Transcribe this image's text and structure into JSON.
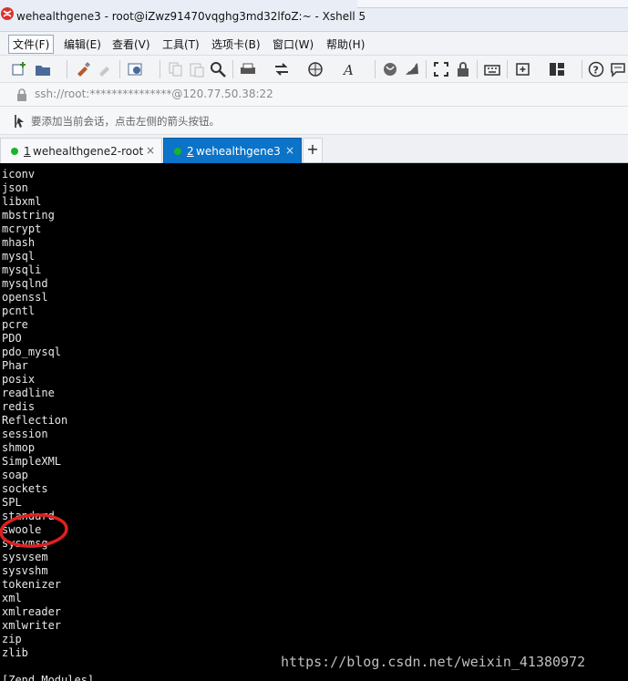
{
  "window": {
    "title": "wehealthgene3 - root@iZwz91470vqghg3md32lfoZ:~ - Xshell 5",
    "accent": "#0b73c8"
  },
  "menu": [
    "文件(F)",
    "编辑(E)",
    "查看(V)",
    "工具(T)",
    "选项卡(B)",
    "窗口(W)",
    "帮助(H)"
  ],
  "toolbar": {
    "icons": [
      "new-session-icon",
      "open-folder-icon",
      "reconnect-icon",
      "disconnect-icon",
      "properties-icon",
      "copy-icon",
      "paste-icon",
      "find-icon",
      "print-icon",
      "transfer-icon",
      "globe-icon",
      "font-icon",
      "xftp-icon",
      "xmanager-icon",
      "fullscreen-icon",
      "lock-icon",
      "keyboard-icon",
      "new-tab-icon",
      "layout-icon",
      "help-icon",
      "chat-icon"
    ]
  },
  "address": {
    "url": "ssh://root:***************@120.77.50.38:22"
  },
  "hint": {
    "text": "要添加当前会话，点击左侧的箭头按钮。"
  },
  "tabs": [
    {
      "number": "1",
      "label": "wehealthgene2-root",
      "status_color": "#17b42f",
      "active": false
    },
    {
      "number": "2",
      "label": "wehealthgene3",
      "status_color": "#17b42f",
      "active": true
    }
  ],
  "terminal": {
    "lines": [
      "iconv",
      "json",
      "libxml",
      "mbstring",
      "mcrypt",
      "mhash",
      "mysql",
      "mysqli",
      "mysqlnd",
      "openssl",
      "pcntl",
      "pcre",
      "PDO",
      "pdo_mysql",
      "Phar",
      "posix",
      "readline",
      "redis",
      "Reflection",
      "session",
      "shmop",
      "SimpleXML",
      "soap",
      "sockets",
      "SPL",
      "standard",
      "swoole",
      "sysvmsg",
      "sysvsem",
      "sysvshm",
      "tokenizer",
      "xml",
      "xmlreader",
      "xmlwriter",
      "zip",
      "zlib",
      "",
      "[Zend Modules]"
    ],
    "highlighted_line": "swoole",
    "highlight_color": "#e02020"
  },
  "watermark": "https://blog.csdn.net/weixin_41380972"
}
